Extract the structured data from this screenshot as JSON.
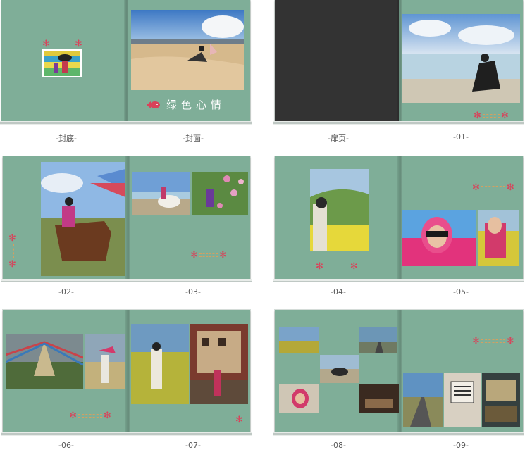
{
  "labels": {
    "back_cover": "-封底-",
    "cover": "-封面-",
    "title_page": "-扉页-",
    "p01": "-01-",
    "p02": "-02-",
    "p03": "-03-",
    "p04": "-04-",
    "p05": "-05-",
    "p06": "-06-",
    "p07": "-07-",
    "p08": "-08-",
    "p09": "-09-"
  },
  "cover": {
    "title": "绿色心情"
  },
  "colors": {
    "page": "#7fae98",
    "accent": "#d9425a",
    "dots": "#d4a060",
    "dark_page": "#333333"
  }
}
